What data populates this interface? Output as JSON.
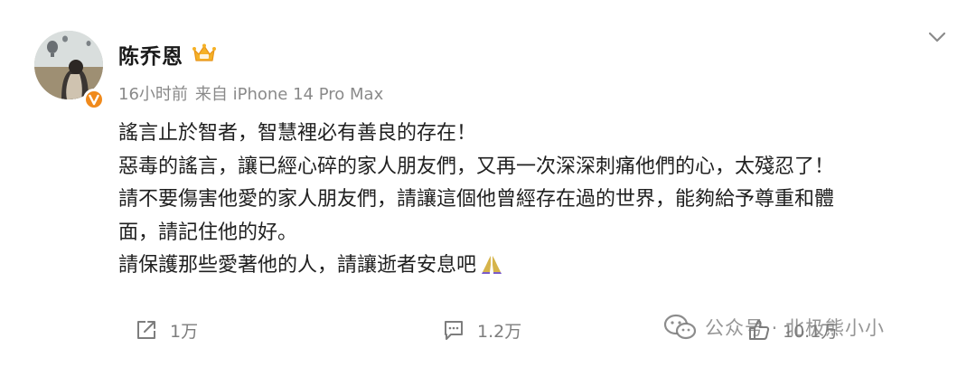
{
  "post": {
    "author": {
      "name": "陈乔恩"
    },
    "meta": {
      "time": "16小时前",
      "source": "来自 iPhone 14 Pro Max"
    },
    "content_lines": [
      "謠言止於智者，智慧裡必有善良的存在！",
      "惡毒的謠言，讓已經心碎的家人朋友們，又再一次深深刺痛他們的心，太殘忍了！",
      "請不要傷害他愛的家人朋友們，請讓這個他曾經存在過的世界，能夠給予尊重和體",
      "面，請記住他的好。",
      "請保護那些愛著他的人，請讓逝者安息吧"
    ]
  },
  "actions": {
    "repost_count": "1万",
    "comment_count": "1.2万",
    "like_count": "10.1万"
  },
  "watermark": {
    "text": "公众号 · 北极熊小小"
  },
  "icons": {
    "avatar": "profile-photo",
    "verified": "verified-badge-icon",
    "crown": "crown-icon",
    "more": "chevron-down-icon",
    "pray": "praying-hands-emoji",
    "repost": "repost-icon",
    "comment": "comment-icon",
    "like": "like-icon",
    "wechat": "wechat-icon"
  },
  "colors": {
    "verified": "#f08a1c",
    "crown": "#f5b126",
    "meta_text": "#8a8a8a",
    "action_text": "#7d7d7d"
  }
}
